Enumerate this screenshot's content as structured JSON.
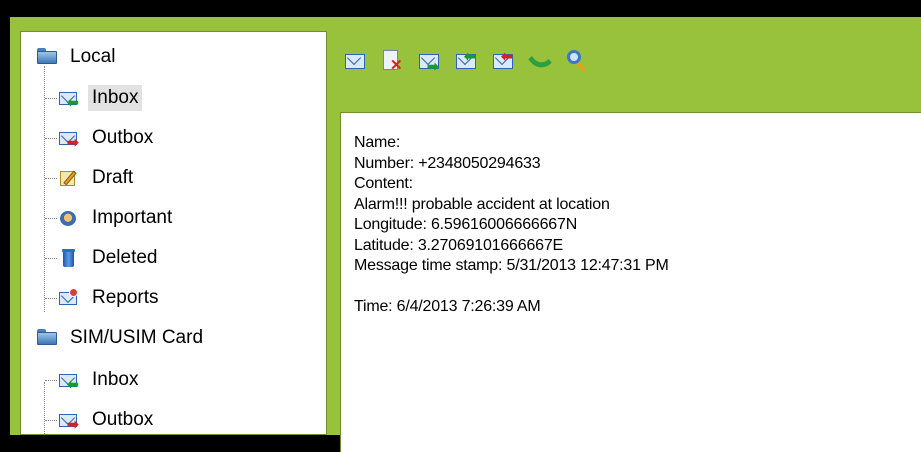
{
  "tree": {
    "local": {
      "label": "Local",
      "items": [
        {
          "label": "Inbox",
          "icon": "inbox-icon",
          "selected": true
        },
        {
          "label": "Outbox",
          "icon": "outbox-icon"
        },
        {
          "label": "Draft",
          "icon": "draft-icon"
        },
        {
          "label": "Important",
          "icon": "important-icon"
        },
        {
          "label": "Deleted",
          "icon": "trash-icon"
        },
        {
          "label": "Reports",
          "icon": "reports-icon"
        }
      ]
    },
    "sim": {
      "label": "SIM/USIM Card",
      "items": [
        {
          "label": "Inbox",
          "icon": "inbox-icon"
        },
        {
          "label": "Outbox",
          "icon": "outbox-icon"
        }
      ]
    }
  },
  "toolbar": {
    "buttons": [
      "new-message-icon",
      "delete-icon",
      "forward-icon",
      "reply-icon",
      "reply-all-icon",
      "call-icon",
      "search-icon"
    ]
  },
  "message": {
    "lines": [
      "Name:",
      "Number: +2348050294633",
      "Content:",
      "Alarm!!! probable accident at location",
      "Longitude: 6.59616006666667N",
      "Latitude: 3.27069101666667E",
      "Message time stamp: 5/31/2013 12:47:31 PM",
      "",
      "Time: 6/4/2013 7:26:39 AM"
    ]
  },
  "colors": {
    "frame": "#99c23c",
    "background": "#000000",
    "envelope": "#2d63b8",
    "selection": "#e2e2e2"
  }
}
